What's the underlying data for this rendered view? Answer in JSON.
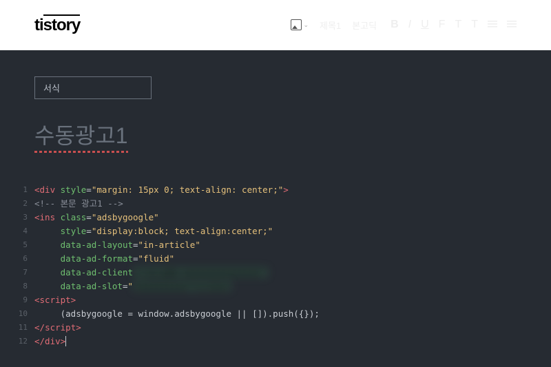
{
  "header": {
    "logo": "tistory",
    "toolbar_items": [
      "제목1",
      "본고딕"
    ],
    "format_buttons": [
      "B",
      "I",
      "U",
      "F",
      "T",
      "T"
    ]
  },
  "editor": {
    "format_label": "서식",
    "title": "수동광고1"
  },
  "code": {
    "lines": [
      {
        "n": 1,
        "segments": [
          {
            "c": "t-tag",
            "t": "<div"
          },
          {
            "c": "t-txt",
            "t": " "
          },
          {
            "c": "t-attr",
            "t": "style"
          },
          {
            "c": "t-op",
            "t": "="
          },
          {
            "c": "t-str",
            "t": "\"margin: 15px 0; text-align: center;\""
          },
          {
            "c": "t-tag",
            "t": ">"
          }
        ]
      },
      {
        "n": 2,
        "segments": [
          {
            "c": "t-cmt",
            "t": "<!-- 본문 광고1 -->"
          }
        ]
      },
      {
        "n": 3,
        "segments": [
          {
            "c": "t-tag",
            "t": "<ins"
          },
          {
            "c": "t-txt",
            "t": " "
          },
          {
            "c": "t-attr",
            "t": "class"
          },
          {
            "c": "t-op",
            "t": "="
          },
          {
            "c": "t-str",
            "t": "\"adsbygoogle\""
          }
        ]
      },
      {
        "n": 4,
        "segments": [
          {
            "c": "t-txt",
            "t": "     "
          },
          {
            "c": "t-attr",
            "t": "style"
          },
          {
            "c": "t-op",
            "t": "="
          },
          {
            "c": "t-str",
            "t": "\"display:block; text-align:center;\""
          }
        ]
      },
      {
        "n": 5,
        "segments": [
          {
            "c": "t-txt",
            "t": "     "
          },
          {
            "c": "t-attr",
            "t": "data-ad-layout"
          },
          {
            "c": "t-op",
            "t": "="
          },
          {
            "c": "t-str",
            "t": "\"in-article\""
          }
        ]
      },
      {
        "n": 6,
        "segments": [
          {
            "c": "t-txt",
            "t": "     "
          },
          {
            "c": "t-attr",
            "t": "data-ad-format"
          },
          {
            "c": "t-op",
            "t": "="
          },
          {
            "c": "t-str",
            "t": "\"fluid\""
          }
        ]
      },
      {
        "n": 7,
        "segments": [
          {
            "c": "t-txt",
            "t": "     "
          },
          {
            "c": "t-attr",
            "t": "data-ad-client"
          },
          {
            "c": "blur",
            "t": "=\"ca-pub-xxxxxxxxxxxxxxx\""
          }
        ]
      },
      {
        "n": 8,
        "segments": [
          {
            "c": "t-txt",
            "t": "     "
          },
          {
            "c": "t-attr",
            "t": "data-ad-slot"
          },
          {
            "c": "t-op",
            "t": "="
          },
          {
            "c": "t-str",
            "t": "\""
          },
          {
            "c": "blur",
            "t": "xxxxxxxxxx\"></ins>"
          }
        ]
      },
      {
        "n": 9,
        "segments": [
          {
            "c": "t-tag",
            "t": "<script>"
          }
        ]
      },
      {
        "n": 10,
        "segments": [
          {
            "c": "t-txt",
            "t": "     (adsbygoogle = window.adsbygoogle || []).push({});"
          }
        ]
      },
      {
        "n": 11,
        "segments": [
          {
            "c": "t-tag",
            "t": "</"
          },
          {
            "c": "t-tag",
            "t": "script>"
          }
        ]
      },
      {
        "n": 12,
        "segments": [
          {
            "c": "t-tag",
            "t": "</div>"
          }
        ],
        "cursor": true
      }
    ]
  }
}
